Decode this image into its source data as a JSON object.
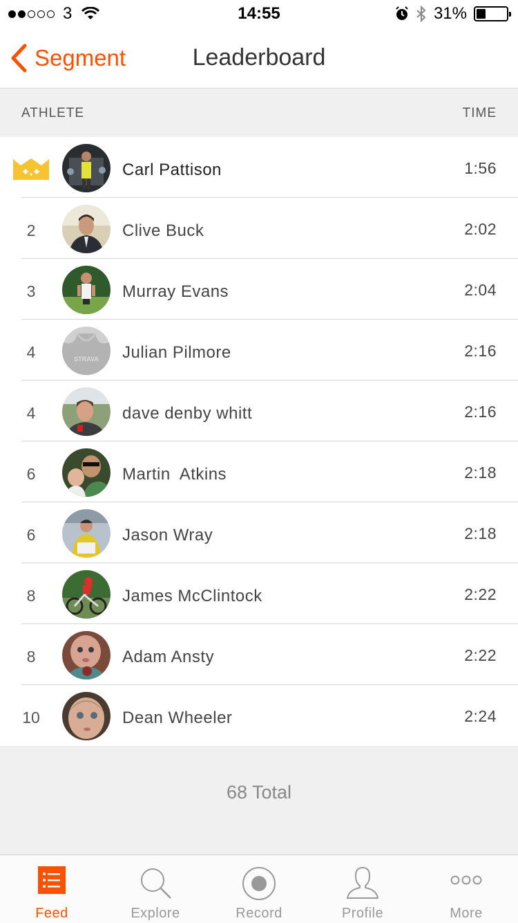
{
  "status_bar": {
    "carrier": "3",
    "time": "14:55",
    "battery": "31%",
    "battery_level": 0.31
  },
  "nav": {
    "back_label": "Segment",
    "title": "Leaderboard"
  },
  "columns": {
    "athlete": "ATHLETE",
    "time": "TIME"
  },
  "leaderboard": [
    {
      "rank": "",
      "name": "Carl Pattison",
      "time": "1:56"
    },
    {
      "rank": "2",
      "name": "Clive Buck",
      "time": "2:02"
    },
    {
      "rank": "3",
      "name": "Murray Evans",
      "time": "2:04"
    },
    {
      "rank": "4",
      "name": "Julian Pilmore",
      "time": "2:16"
    },
    {
      "rank": "4",
      "name": "dave denby whitt",
      "time": "2:16"
    },
    {
      "rank": "6",
      "name": "Martin  Atkins",
      "time": "2:18"
    },
    {
      "rank": "6",
      "name": "Jason Wray",
      "time": "2:18"
    },
    {
      "rank": "8",
      "name": "James McClintock",
      "time": "2:22"
    },
    {
      "rank": "8",
      "name": "Adam Ansty",
      "time": "2:22"
    },
    {
      "rank": "10",
      "name": "Dean Wheeler",
      "time": "2:24"
    }
  ],
  "total": "68 Total",
  "tabs": [
    {
      "label": "Feed",
      "icon": "feed-icon"
    },
    {
      "label": "Explore",
      "icon": "search-icon"
    },
    {
      "label": "Record",
      "icon": "record-icon"
    },
    {
      "label": "Profile",
      "icon": "profile-icon"
    },
    {
      "label": "More",
      "icon": "more-icon"
    }
  ],
  "colors": {
    "accent": "#fc5200",
    "crown": "#f6c431"
  }
}
